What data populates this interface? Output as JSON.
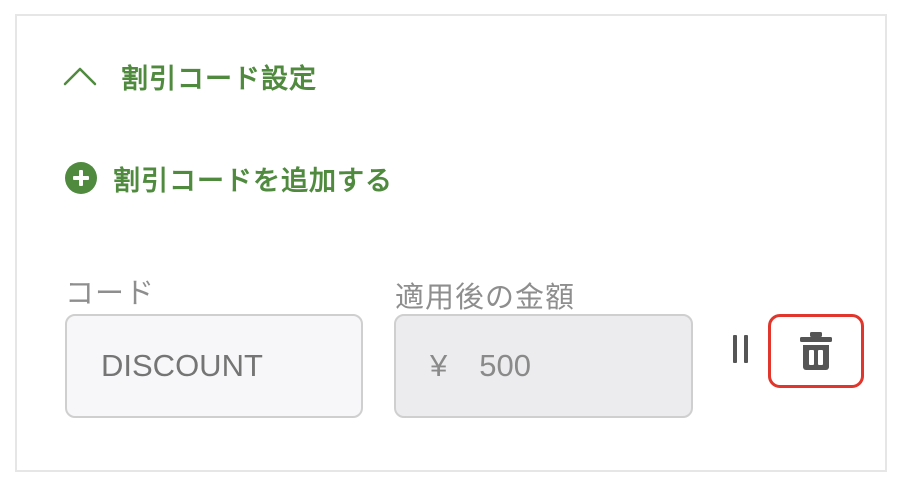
{
  "section": {
    "title": "割引コード設定",
    "accent_color": "#4f8a3f"
  },
  "add_action": {
    "label": "割引コードを追加する"
  },
  "fields": {
    "code_label": "コード",
    "code_placeholder": "DISCOUNT",
    "amount_label": "適用後の金額",
    "currency_symbol": "¥",
    "amount_value": "500"
  },
  "icons": {
    "collapse": "chevron-up-icon",
    "add": "plus-circle-icon",
    "drag": "drag-handle-icon",
    "delete": "trash-icon"
  },
  "colors": {
    "highlight_border": "#e0362c"
  }
}
